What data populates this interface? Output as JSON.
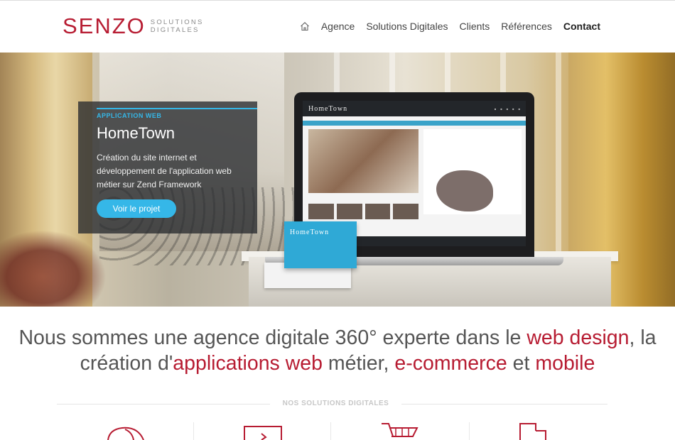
{
  "header": {
    "logo_mark": "SENZO",
    "logo_sub_line1": "SOLUTIONS",
    "logo_sub_line2": "DIGITALES",
    "nav": [
      {
        "label": "Agence"
      },
      {
        "label": "Solutions Digitales"
      },
      {
        "label": "Clients"
      },
      {
        "label": "Références"
      },
      {
        "label": "Contact",
        "active": true
      }
    ],
    "home_icon": "home-icon"
  },
  "hero": {
    "tag": "APPLICATION WEB",
    "title": "HomeTown",
    "description": "Création du site internet et développement de l'application web métier sur Zend Framework",
    "button_label": "Voir le projet",
    "mockup_logo": "HomeTown",
    "card_logo": "HomeTown"
  },
  "tagline": {
    "part1": "Nous sommes une agence digitale 360° experte dans le ",
    "hl1": "web design",
    "part2": ", la création d'",
    "hl2": "applications web",
    "part3": " métier, ",
    "hl3": "e-commerce",
    "part4": " et ",
    "hl4": "mobile"
  },
  "solutions": {
    "title": "NOS SOLUTIONS DIGITALES",
    "icons": [
      "web-design-icon",
      "web-application-icon",
      "e-commerce-cart-icon",
      "mobile-icon"
    ]
  },
  "colors": {
    "brand": "#b71c32",
    "accent": "#35b7e8",
    "text": "#555555"
  }
}
